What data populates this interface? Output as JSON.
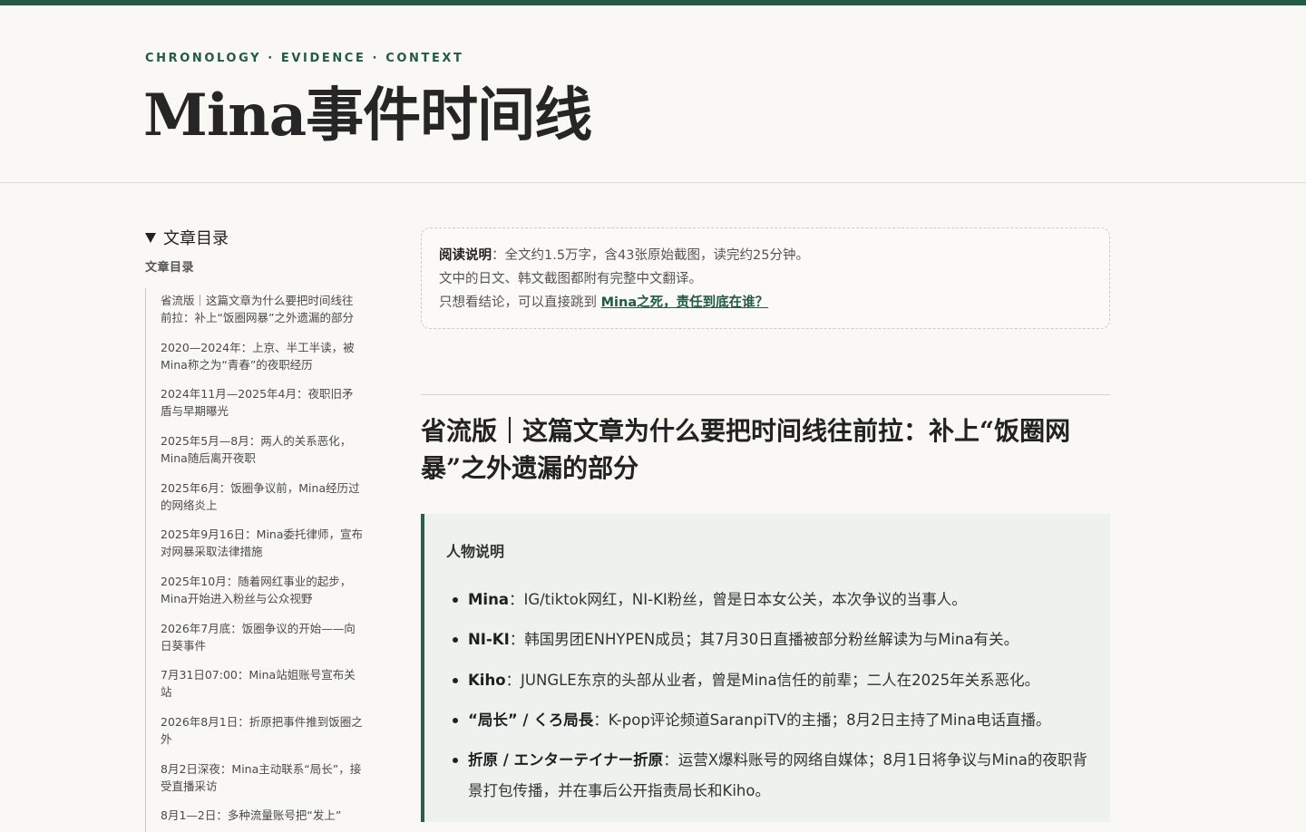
{
  "header": {
    "eyebrow": "CHRONOLOGY · EVIDENCE · CONTEXT",
    "title": "Mina事件时间线"
  },
  "toc": {
    "summary": "文章目录",
    "heading": "文章目录",
    "items": [
      "省流版｜这篇文章为什么要把时间线往前拉：补上“饭圈网暴”之外遗漏的部分",
      "2020—2024年：上京、半工半读，被Mina称之为“青春”的夜职经历",
      "2024年11月—2025年4月：夜职旧矛盾与早期曝光",
      "2025年5月—8月：两人的关系恶化，Mina随后离开夜职",
      "2025年6月：饭圈争议前，Mina经历过的网络炎上",
      "2025年9月16日：Mina委托律师，宣布对网暴采取法律措施",
      "2025年10月：随着网红事业的起步，Mina开始进入粉丝与公众视野",
      "2026年7月底：饭圈争议的开始——向日葵事件",
      "7月31日07:00：Mina站姐账号宣布关站",
      "2026年8月1日：折原把事件推到饭圈之外",
      "8月2日深夜：Mina主动联系“局长”，接受直播采访",
      "8月1—2日：多种流量账号把“发上”"
    ]
  },
  "notice": {
    "label": "阅读说明",
    "line1": "：全文约1.5万字，含43张原始截图，读完约25分钟。",
    "line2": "文中的日文、韩文截图都附有完整中文翻译。",
    "line3_prefix": "只想看结论，可以直接跳到 ",
    "line3_link": "Mina之死，责任到底在谁？"
  },
  "section": {
    "title": "省流版｜这篇文章为什么要把时间线往前拉：补上“饭圈网暴”之外遗漏的部分"
  },
  "callout": {
    "title": "人物说明",
    "people": [
      {
        "name": "Mina",
        "desc": "：IG/tiktok网红，NI-KI粉丝，曾是日本女公关，本次争议的当事人。"
      },
      {
        "name": "NI-KI",
        "desc": "：韩国男团ENHYPEN成员；其7月30日直播被部分粉丝解读为与Mina有关。"
      },
      {
        "name": "Kiho",
        "desc": "：JUNGLE东京的头部从业者，曾是Mina信任的前辈；二人在2025年关系恶化。"
      },
      {
        "name": "“局长” / くろ局長",
        "desc": "：K-pop评论频道SaranpiTV的主播；8月2日主持了Mina电话直播。"
      },
      {
        "name": "折原 / エンターテイナー折原",
        "desc": "：运营X爆料账号的网络自媒体；8月1日将争议与Mina的夜职背景打包传播，并在事后公开指责局长和Kiho。"
      }
    ]
  }
}
